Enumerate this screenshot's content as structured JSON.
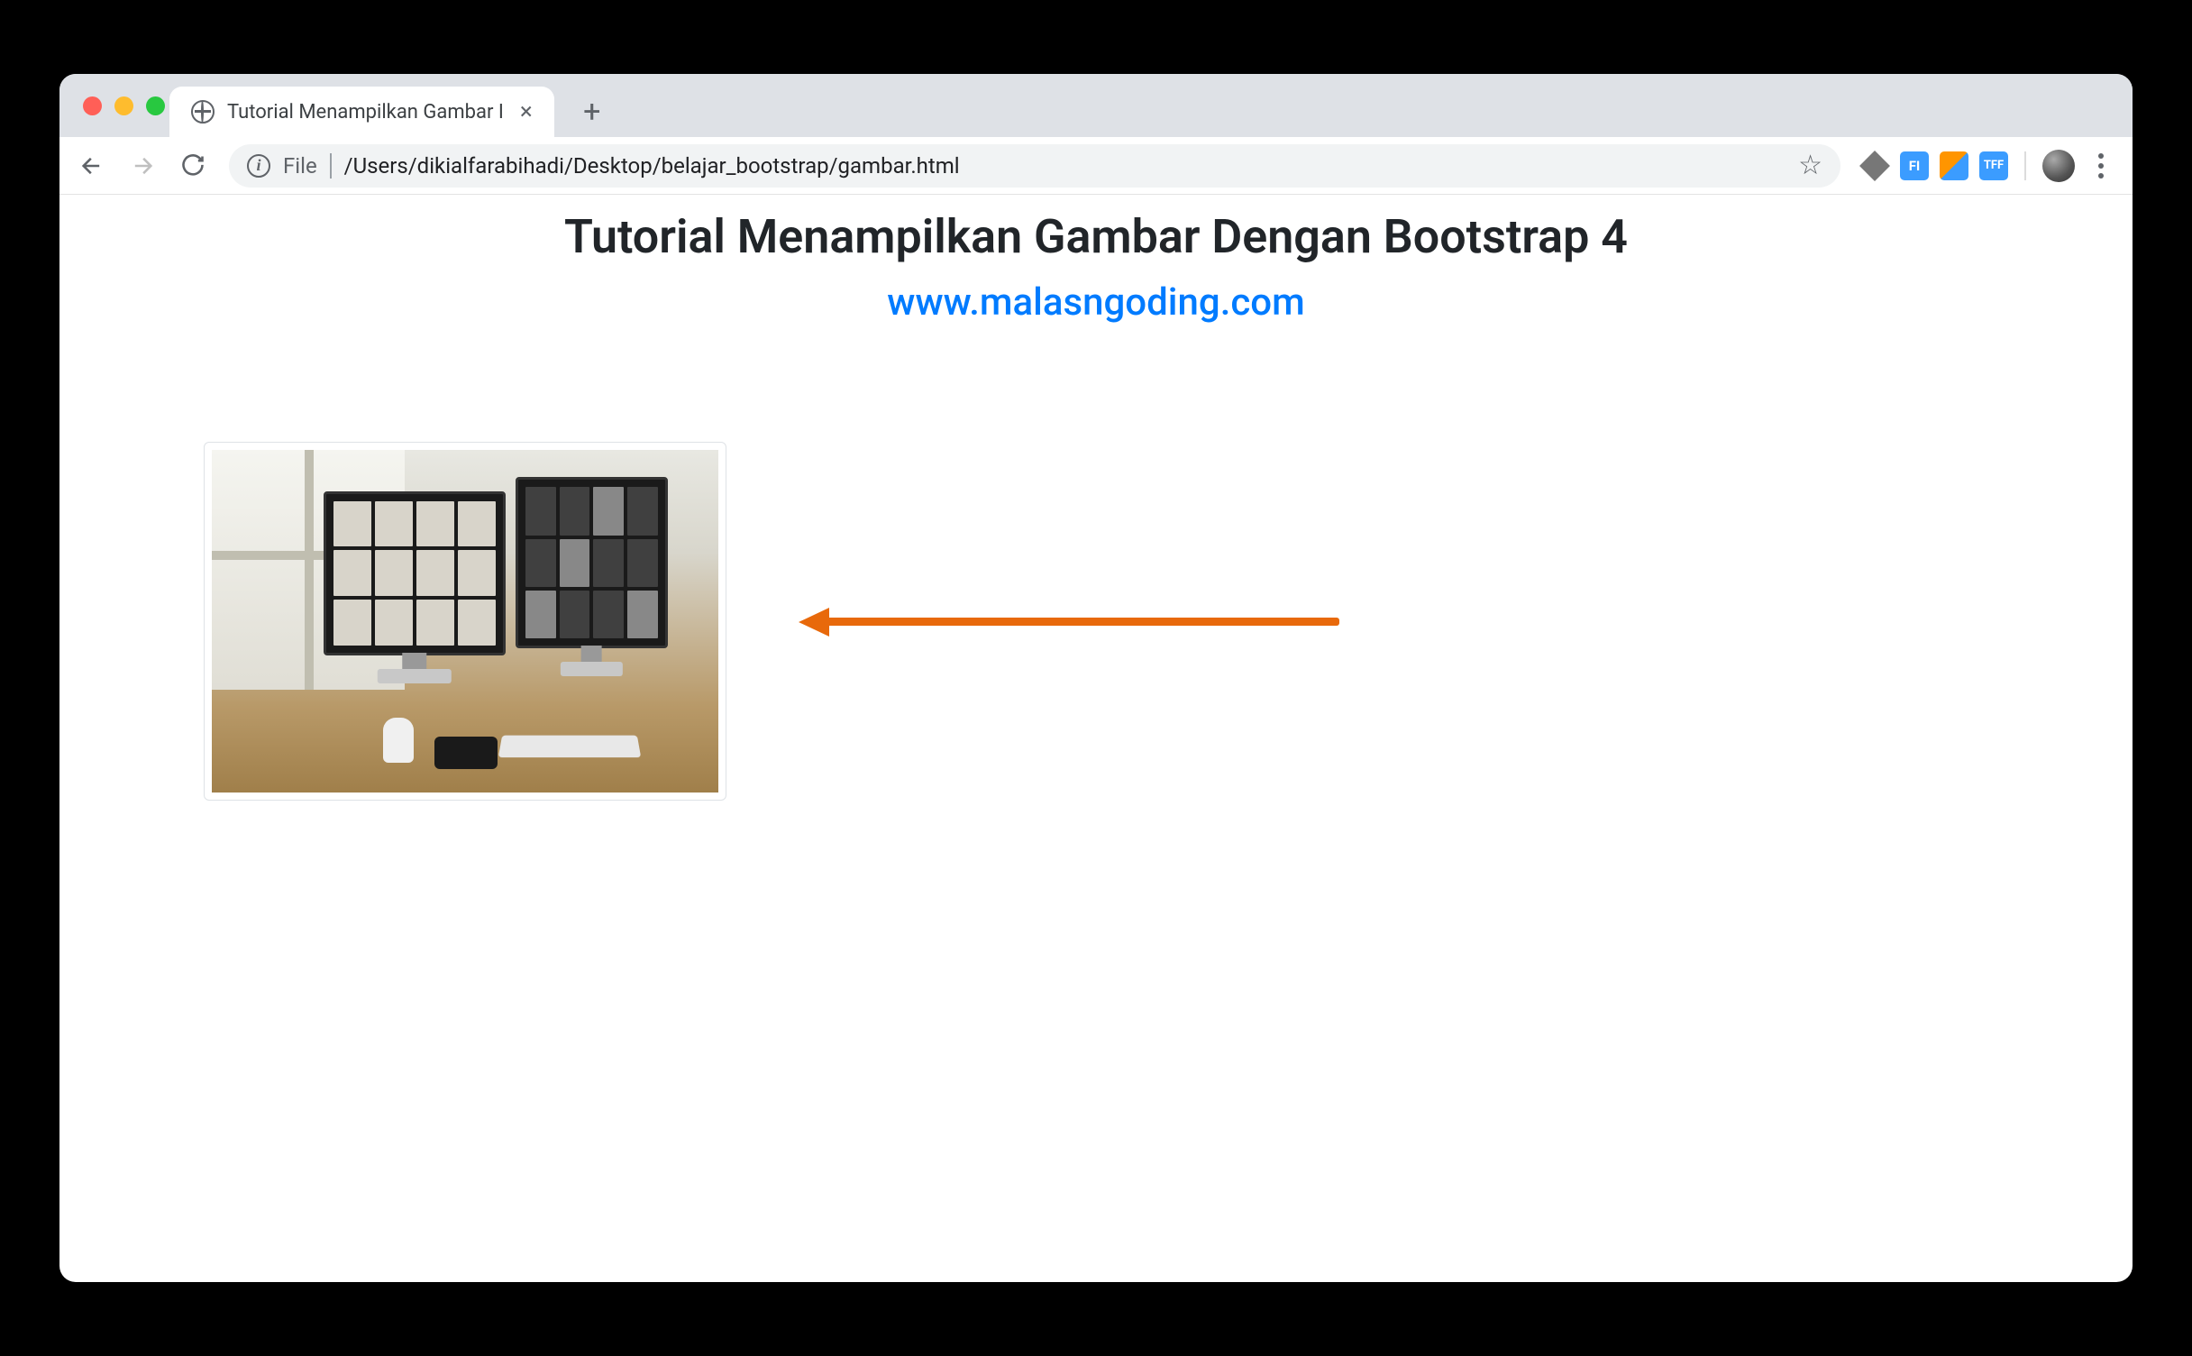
{
  "browser": {
    "tab_title": "Tutorial Menampilkan Gambar I",
    "address_prefix": "File",
    "address_path": "/Users/dikialfarabihadi/Desktop/belajar_bootstrap/gambar.html",
    "extensions": {
      "fi": "FI",
      "tff": "TFF"
    }
  },
  "page": {
    "title": "Tutorial Menampilkan Gambar Dengan Bootstrap 4",
    "link_text": "www.malasngoding.com"
  },
  "colors": {
    "link": "#007bff",
    "arrow": "#e8690b"
  }
}
